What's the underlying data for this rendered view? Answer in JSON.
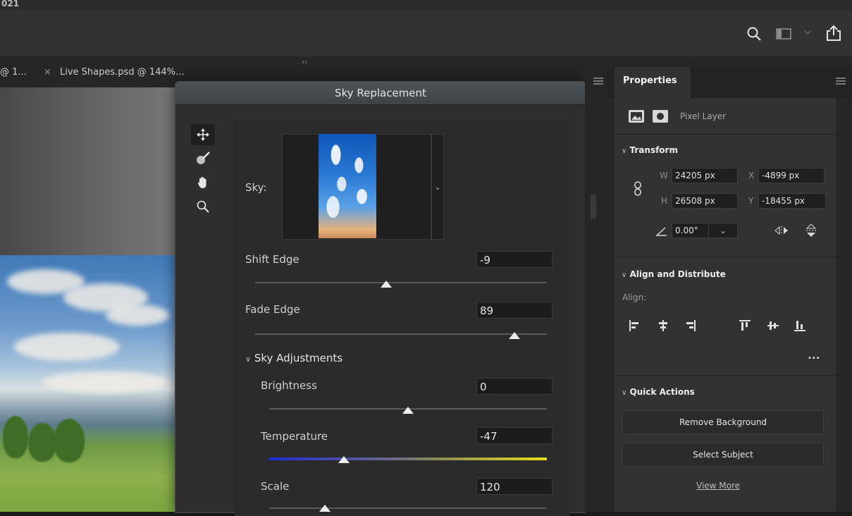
{
  "app": {
    "title_fragment": "021"
  },
  "toolbar": {
    "icons": [
      "search-icon",
      "workspace-icon",
      "chevron-down-icon",
      "share-icon"
    ]
  },
  "document_tabs": [
    {
      "label": "@ 1..."
    },
    {
      "close": "×",
      "label": "Live Shapes.psd @ 144%..."
    }
  ],
  "collapse_glyphs": {
    "left": "‹‹",
    "right": "››"
  },
  "dialog": {
    "title": "Sky Replacement",
    "tools": [
      "move-sky-icon",
      "sky-brush-icon",
      "hand-icon",
      "zoom-icon"
    ],
    "sky_label": "Sky:",
    "fields": [
      {
        "label": "Shift Edge",
        "value": "-9",
        "slider": 0.45
      },
      {
        "label": "Fade Edge",
        "value": "89",
        "slider": 0.89
      }
    ],
    "section": "Sky Adjustments",
    "adjustments": [
      {
        "label": "Brightness",
        "value": "0",
        "slider": 0.5
      },
      {
        "label": "Temperature",
        "value": "-47",
        "slider": 0.27
      },
      {
        "label": "Scale",
        "value": "120",
        "slider": 0.2
      }
    ]
  },
  "panel": {
    "tab": "Properties",
    "layer_type": "Pixel Layer",
    "transform": {
      "heading": "Transform",
      "w_label": "W",
      "w": "24205 px",
      "x_label": "X",
      "x": "-4899 px",
      "h_label": "H",
      "h": "26508 px",
      "y_label": "Y",
      "y": "-18455 px",
      "angle": "0.00°"
    },
    "align": {
      "heading": "Align and Distribute",
      "label": "Align:",
      "more": "•••"
    },
    "quick_actions": {
      "heading": "Quick Actions",
      "remove_bg": "Remove Background",
      "select_subject": "Select Subject",
      "view_more": "View More"
    }
  },
  "colors": {
    "accent_blue": "#1f2bd6",
    "accent_yellow": "#e8e018",
    "panel_bg": "#323232"
  }
}
